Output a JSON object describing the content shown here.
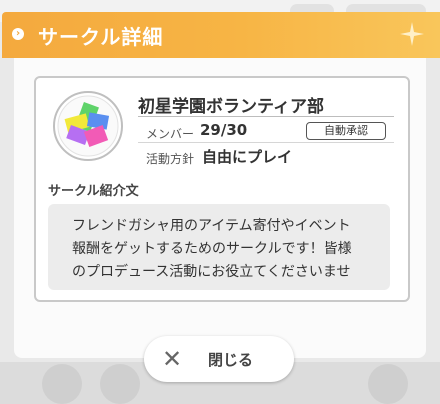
{
  "header": {
    "title": "サークル詳細",
    "accent_color": "#f4a93e"
  },
  "circle": {
    "name": "初星学園ボランティア部",
    "member_label": "メンバー",
    "member_count": "29/30",
    "approval_badge": "自動承認",
    "policy_label": "活動方針",
    "policy_value": "自由にプレイ",
    "emblem_icon": "circle-emblem-icon"
  },
  "intro": {
    "label": "サークル紹介文",
    "lines": [
      "フレンドガシャ用のアイテム寄付やイベント",
      "報酬をゲットするためのサークルです！皆様",
      "のプロデュース活動にお役立てくださいませ"
    ]
  },
  "close_button": {
    "icon": "close-icon",
    "label": "閉じる"
  }
}
